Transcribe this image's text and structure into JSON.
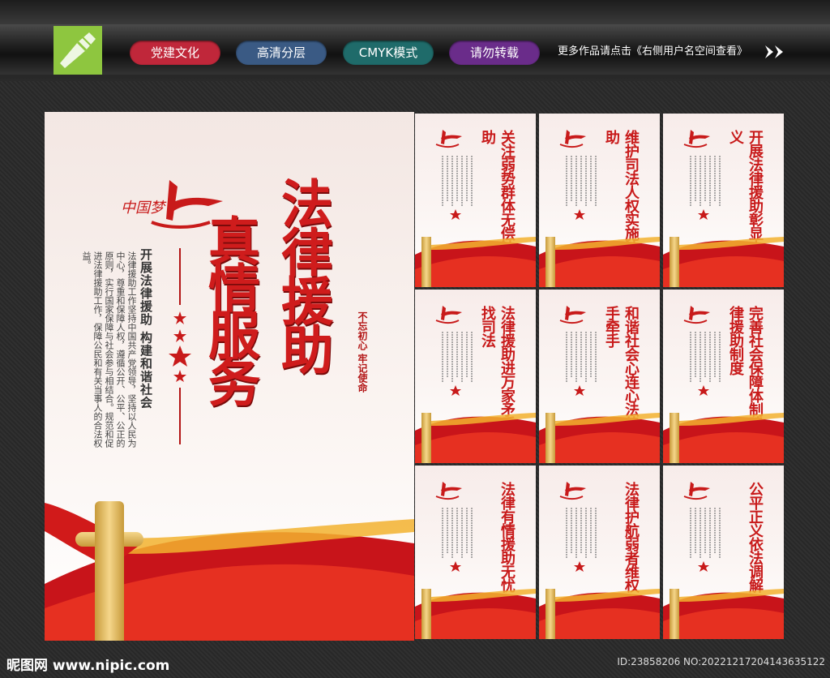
{
  "topbar": {
    "tags": [
      {
        "label": "党建文化",
        "color": "#c0273a"
      },
      {
        "label": "高清分层",
        "color": "#3a5a84"
      },
      {
        "label": "CMYK模式",
        "color": "#1f6b6a"
      },
      {
        "label": "请勿转载",
        "color": "#6a2c8a"
      }
    ],
    "more_text": "更多作品请点击《右侧用户名空间查看》"
  },
  "main_board": {
    "title_line1": "法律援助",
    "title_line2": "真情服务",
    "subtitle": "开展法律援助 构建和谐社会",
    "body_text": "法律援助工作坚持中国共产党领导，坚持以人民为中心，尊重和保障人权，遵循公开、公平、公正的原则，实行国家保障与社会参与相结合。规范和促进法律援助工作，保障公民和有关当事人的合法权益。",
    "slogan": "不忘初心 牢记使命",
    "logo_text": "中国梦"
  },
  "panels": [
    {
      "title": "关注弱势群体无偿法律援助"
    },
    {
      "title": "维护司法人权实施法律援助"
    },
    {
      "title": "开展法律援助彰显人间正义"
    },
    {
      "title": "法律援助进万家矛盾化解找司法"
    },
    {
      "title": "和谐社会心连心法律援助手牵手"
    },
    {
      "title": "完善社会保障体制建立法律援助制度"
    },
    {
      "title": "法律有情援助无忧"
    },
    {
      "title": "法律护航弱者维权"
    },
    {
      "title": "公平正义依法调解"
    }
  ],
  "footer": {
    "site": "昵图网 www.nipic.com",
    "id_text": "ID:23858206 NO:20221217204143635122"
  }
}
